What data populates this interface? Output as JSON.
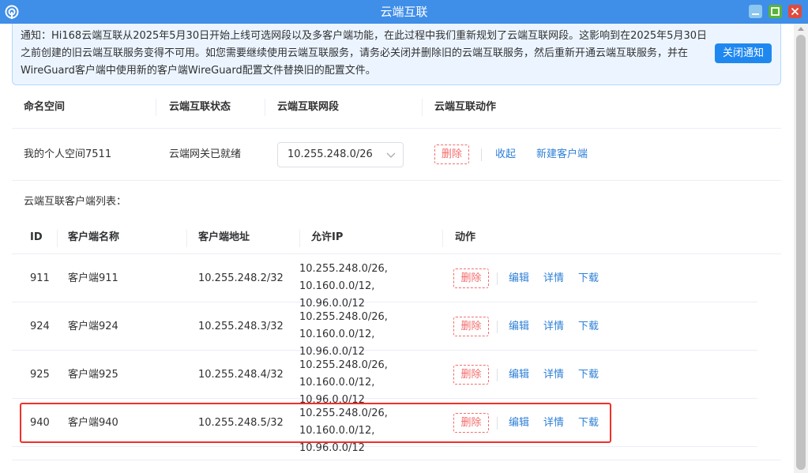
{
  "window": {
    "title": "云端互联"
  },
  "notice": {
    "text": "通知：Hi168云端互联从2025年5月30日开始上线可选网段以及多客户端功能，在此过程中我们重新规划了云端互联网段。这影响到在2025年5月30日之前创建的旧云端互联服务变得不可用。如您需要继续使用云端互联服务，请务必关闭并删除旧的云端互联服务，然后重新开通云端互联服务，并在WireGuard客户端中使用新的客户端WireGuard配置文件替换旧的配置文件。",
    "close_label": "关闭通知"
  },
  "namespace_table": {
    "headers": [
      "命名空间",
      "云端互联状态",
      "云端互联网段",
      "云端互联动作"
    ],
    "row": {
      "namespace": "我的个人空间7511",
      "status": "云端网关已就绪",
      "segment": "10.255.248.0/26",
      "delete_label": "删除",
      "collapse_label": "收起",
      "new_client_label": "新建客户端"
    }
  },
  "client_list_label": "云端互联客户端列表：",
  "client_table": {
    "headers": [
      "ID",
      "客户端名称",
      "客户端地址",
      "允许IP",
      "动作"
    ],
    "rows": [
      {
        "id": "911",
        "name": "客户端911",
        "address": "10.255.248.2/32",
        "ip_line1": "10.255.248.0/26,",
        "ip_line2": "10.160.0.0/12, 10.96.0.0/12",
        "delete": "删除",
        "edit": "编辑",
        "details": "详情",
        "download": "下载"
      },
      {
        "id": "924",
        "name": "客户端924",
        "address": "10.255.248.3/32",
        "ip_line1": "10.255.248.0/26,",
        "ip_line2": "10.160.0.0/12, 10.96.0.0/12",
        "delete": "删除",
        "edit": "编辑",
        "details": "详情",
        "download": "下载"
      },
      {
        "id": "925",
        "name": "客户端925",
        "address": "10.255.248.4/32",
        "ip_line1": "10.255.248.0/26,",
        "ip_line2": "10.160.0.0/12, 10.96.0.0/12",
        "delete": "删除",
        "edit": "编辑",
        "details": "详情",
        "download": "下载"
      },
      {
        "id": "940",
        "name": "客户端940",
        "address": "10.255.248.5/32",
        "ip_line1": "10.255.248.0/26,",
        "ip_line2": "10.160.0.0/12, 10.96.0.0/12",
        "delete": "删除",
        "edit": "编辑",
        "details": "详情",
        "download": "下载"
      }
    ]
  },
  "colors": {
    "titlebar": "#3f8ee8",
    "primary": "#1f88f0",
    "link": "#2d7fd6",
    "danger": "#f56c6c",
    "highlight": "#f0302a"
  }
}
